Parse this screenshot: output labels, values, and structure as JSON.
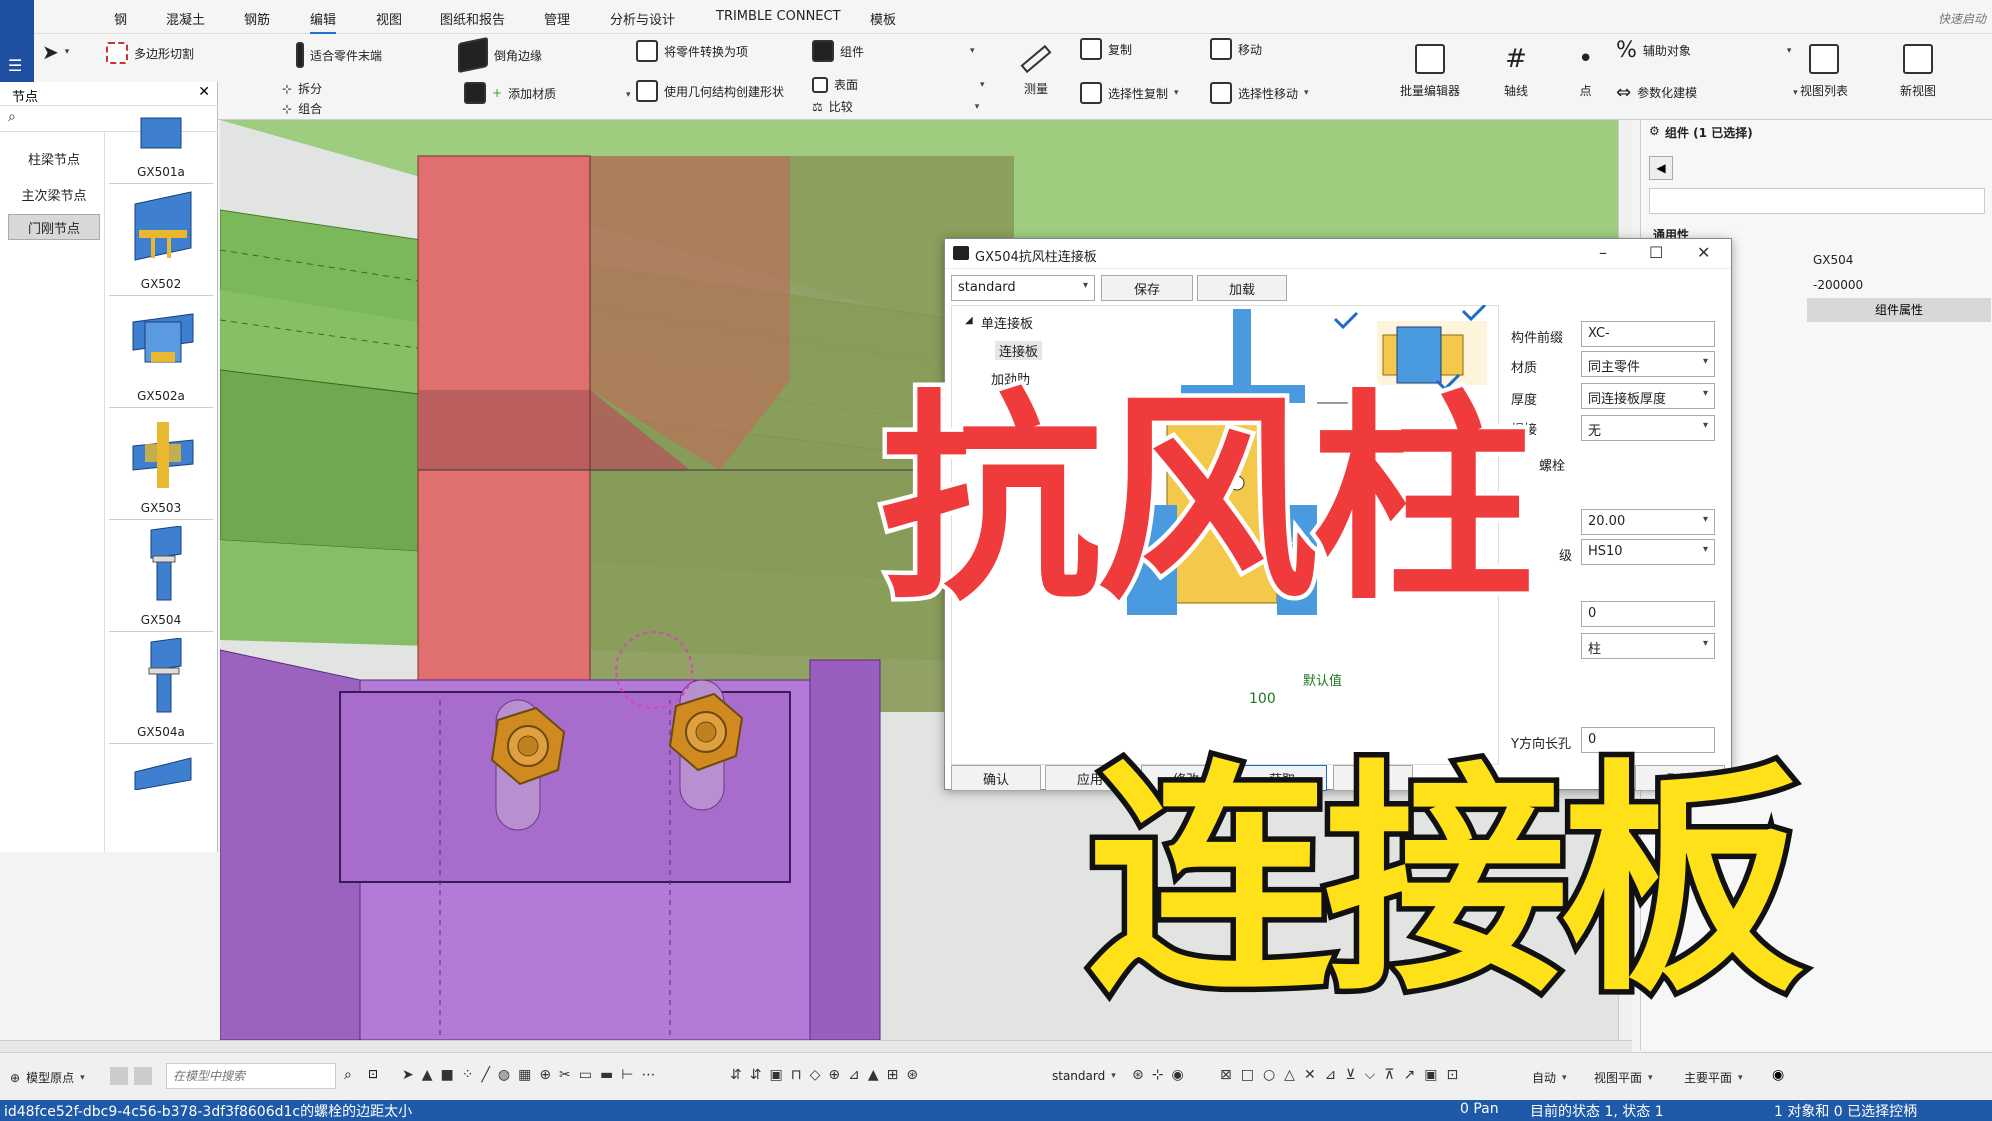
{
  "menu": {
    "items": [
      "钢",
      "混凝土",
      "钢筋",
      "编辑",
      "视图",
      "图纸和报告",
      "管理",
      "分析与设计",
      "TRIMBLE CONNECT",
      "模板"
    ],
    "active_index": 3,
    "quickstart": "快速启动"
  },
  "ribbon": {
    "polygon_cut": "多边形切割",
    "fit_part_end": "适合零件末端",
    "split": "拆分",
    "combine": "组合",
    "chamfer_edge": "倒角边缘",
    "add_material": "添加材质",
    "convert_part": "将零件转换为项",
    "create_shape": "使用几何结构创建形状",
    "component": "组件",
    "surface": "表面",
    "compare": "比较",
    "measure": "测量",
    "copy": "复制",
    "selective_copy": "选择性复制",
    "move": "移动",
    "selective_move": "选择性移动",
    "batch_editor": "批量编辑器",
    "axis": "轴线",
    "point": "点",
    "aux_object": "辅助对象",
    "param_model": "参数化建模",
    "view_list": "视图列表",
    "new_view": "新视图"
  },
  "left_panel": {
    "title": "节点",
    "close": "✕",
    "categories": [
      "柱梁节点",
      "主次梁节点",
      "门刚节点"
    ],
    "selected_category": 2,
    "thumbnails": [
      "GX501a",
      "GX502",
      "GX502a",
      "GX503",
      "GX504",
      "GX504a"
    ]
  },
  "right_panel": {
    "header": "组件 (1 已选择)",
    "section": "通用性",
    "name_value": "GX504",
    "num_value": "-200000",
    "attr_button": "组件属性"
  },
  "dialog": {
    "title": "GX504抗风柱连接板",
    "preset": "standard",
    "save": "保存",
    "load": "加载",
    "tree_root": "单连接板",
    "tree_items": [
      "连接板",
      "加劲肋"
    ],
    "fields": [
      {
        "label": "构件前缀",
        "value": "XC-",
        "type": "text"
      },
      {
        "label": "材质",
        "value": "同主零件",
        "type": "select"
      },
      {
        "label": "厚度",
        "value": "同连接板厚度",
        "type": "select"
      },
      {
        "label": "焊接",
        "value": "无",
        "type": "select"
      }
    ],
    "bolt_section": "螺栓",
    "bolt_size": "20.00",
    "bolt_grade_label": "级",
    "bolt_grade": "HS10",
    "bolt_zero": "0",
    "bolt_target": "柱",
    "y_slot_label": "Y方向长孔",
    "y_slot_value": "0",
    "dim_100": "100",
    "default_text": "默认值",
    "buttons": [
      "确认",
      "应用",
      "修改",
      "获取",
      "☑/☐",
      "取消"
    ]
  },
  "overlay": {
    "title_line1": "抗风柱",
    "title_line2": "连接板"
  },
  "bottom_toolbar": {
    "origin": "模型原点",
    "search_placeholder": "在模型中搜索",
    "preset": "standard",
    "auto": "自动",
    "view_plane": "视图平面",
    "main_plane": "主要平面"
  },
  "status_bar": {
    "message": "id48fce52f-dbc9-4c56-b378-3df3f8606d1c的螺栓的边距太小",
    "pan": "0 Pan",
    "state": "目前的状态 1, 状态 1",
    "selection": "1 对象和 0 已选择控柄"
  },
  "colors": {
    "status_blue": "#1f5aa8",
    "title_red": "#ef3b3b",
    "title_yellow": "#ffe11a",
    "column_red": "#e07070",
    "plate_purple": "#a060c0",
    "beam_green": "#8cc060",
    "bolt_orange": "#d08a20"
  }
}
